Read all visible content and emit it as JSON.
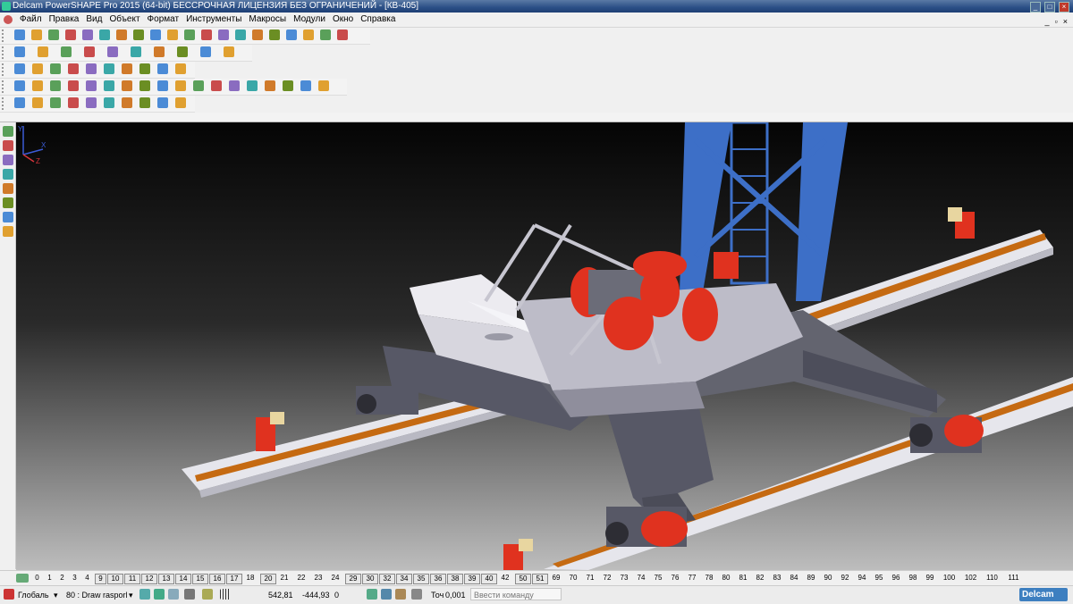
{
  "window": {
    "title": "Delcam PowerSHAPE Pro 2015 (64-bit) БЕССРОЧНАЯ ЛИЦЕНЗИЯ БЕЗ ОГРАНИЧЕНИЙ - [КВ-405]",
    "controls": [
      "_",
      "□",
      "×"
    ]
  },
  "menu": {
    "items": [
      "Файл",
      "Правка",
      "Вид",
      "Объект",
      "Формат",
      "Инструменты",
      "Макросы",
      "Модули",
      "Окно",
      "Справка"
    ],
    "mdi_controls": [
      "_",
      "▫",
      "×"
    ]
  },
  "toolbars": {
    "row1_icons": [
      "new-file-icon",
      "open-file-icon",
      "save-icon",
      "print-icon",
      "cut-icon",
      "copy-icon",
      "paste-icon",
      "undo-icon",
      "redo-icon",
      "zoom-icon",
      "fit-icon",
      "line-icon",
      "arc-icon",
      "circle-icon",
      "curve-icon",
      "surface-icon",
      "solid-icon",
      "shade-icon",
      "wireframe-icon",
      "tools-icon"
    ],
    "row2_icons": [
      "view-top-icon",
      "view-front-icon",
      "view-side-icon",
      "view-iso-icon",
      "rotate-icon",
      "pan-icon",
      "zoom-in-icon",
      "zoom-out-icon",
      "select-icon",
      "render-icon"
    ],
    "row3_icons": [
      "shade-icon",
      "material-icon",
      "light-icon",
      "texture-icon",
      "analysis-icon",
      "color-icon",
      "layer-icon",
      "workplane-icon",
      "dimension-icon",
      "export-icon"
    ]
  },
  "levels": {
    "numbers": [
      "0",
      "1",
      "2",
      "3",
      "4",
      "9",
      "10",
      "11",
      "12",
      "13",
      "14",
      "15",
      "16",
      "17",
      "18",
      "20",
      "21",
      "22",
      "23",
      "24",
      "29",
      "30",
      "32",
      "34",
      "35",
      "36",
      "38",
      "39",
      "40",
      "42",
      "50",
      "51",
      "69",
      "70",
      "71",
      "72",
      "73",
      "74",
      "75",
      "76",
      "77",
      "78",
      "80",
      "81",
      "82",
      "83",
      "84",
      "89",
      "90",
      "92",
      "94",
      "95",
      "96",
      "98",
      "99",
      "100",
      "102",
      "110",
      "111"
    ],
    "boxed": [
      "9",
      "10",
      "11",
      "12",
      "13",
      "14",
      "15",
      "16",
      "17",
      "20",
      "29",
      "30",
      "32",
      "34",
      "35",
      "36",
      "38",
      "39",
      "40",
      "50",
      "51"
    ]
  },
  "status": {
    "workplane": "Глобаль",
    "level": "80 : Draw rasporl",
    "x": "542,81",
    "y": "-444,93",
    "z": "0",
    "tolerance_label": "Точ",
    "tolerance": "0,001",
    "command_placeholder": "Ввести команду",
    "logo": "Delcam"
  },
  "colors": {
    "title_bar": "#2b4f86",
    "model_red": "#e0321f",
    "model_blue": "#3d6fc7",
    "model_white": "#e6e6ec",
    "model_dark": "#575866",
    "rail_orange": "#c56a12"
  },
  "axis_labels": [
    "Y",
    "X",
    "Z"
  ]
}
